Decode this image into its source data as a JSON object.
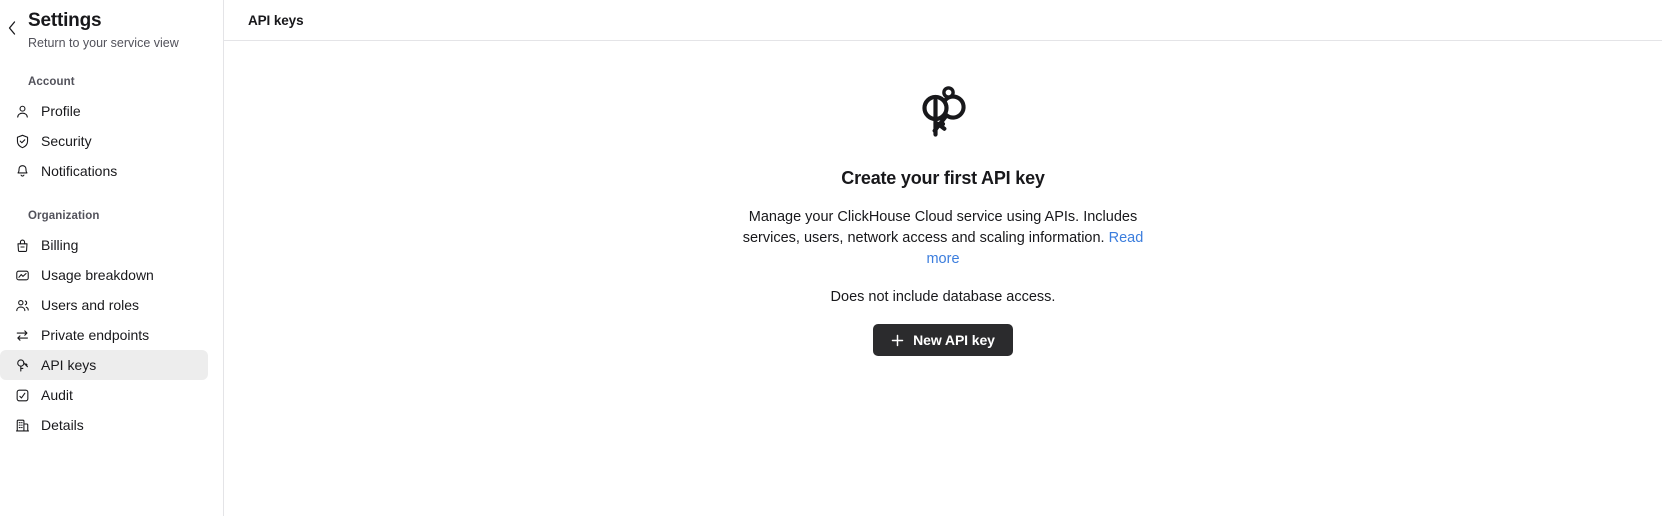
{
  "sidebar": {
    "back_icon": "chevron-left-icon",
    "title": "Settings",
    "subtitle": "Return to your service view",
    "groups": [
      {
        "label": "Account",
        "items": [
          {
            "label": "Profile",
            "icon": "user-icon",
            "active": false
          },
          {
            "label": "Security",
            "icon": "shield-check-icon",
            "active": false
          },
          {
            "label": "Notifications",
            "icon": "bell-icon",
            "active": false
          }
        ]
      },
      {
        "label": "Organization",
        "items": [
          {
            "label": "Billing",
            "icon": "bag-icon",
            "active": false
          },
          {
            "label": "Usage breakdown",
            "icon": "chart-box-icon",
            "active": false
          },
          {
            "label": "Users and roles",
            "icon": "users-icon",
            "active": false
          },
          {
            "label": "Private endpoints",
            "icon": "arrows-exchange-icon",
            "active": false
          },
          {
            "label": "API keys",
            "icon": "key-icon",
            "active": true
          },
          {
            "label": "Audit",
            "icon": "check-box-icon",
            "active": false
          },
          {
            "label": "Details",
            "icon": "building-icon",
            "active": false
          }
        ]
      }
    ]
  },
  "main": {
    "header_title": "API keys",
    "empty_state": {
      "illustration_icon": "two-keys-icon",
      "title": "Create your first API key",
      "body_text": "Manage your ClickHouse Cloud service using APIs. Includes services, users, network access and scaling information.",
      "link_label": "Read more",
      "note": "Does not include database access.",
      "button_label": "New API key",
      "button_icon": "plus-icon"
    }
  },
  "colors": {
    "accent_link": "#3b7ddd",
    "button_bg": "#2b2b2d",
    "active_item_bg": "#ededed",
    "border": "#e4e4e7",
    "text_primary": "#18181b",
    "text_muted": "#52525b"
  }
}
